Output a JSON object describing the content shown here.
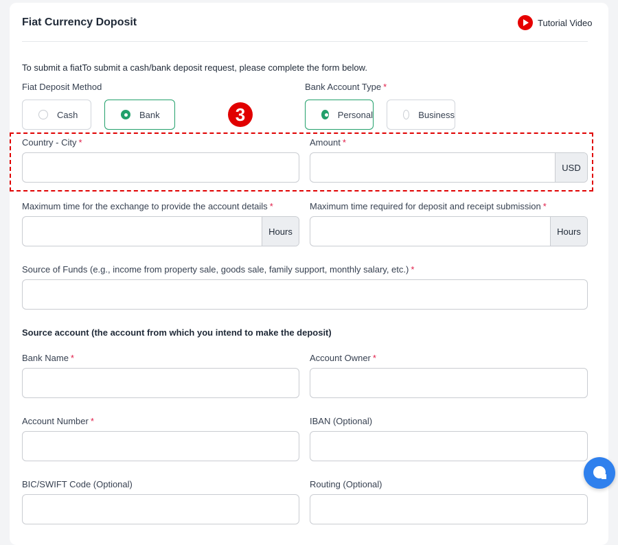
{
  "header": {
    "title": "Fiat Currency Doposit",
    "tutorial_label": "Tutorial Video"
  },
  "intro": "To submit a fiatTo submit a cash/bank deposit request, please complete the form below.",
  "deposit_method": {
    "label": "Fiat Deposit Method",
    "options": [
      {
        "label": "Cash",
        "selected": false
      },
      {
        "label": "Bank",
        "selected": true
      }
    ]
  },
  "account_type": {
    "label": "Bank Account Type",
    "required_mark": "*",
    "options": [
      {
        "label": "Personal",
        "selected": true
      },
      {
        "label": "Business",
        "selected": false
      }
    ]
  },
  "step_marker": "3",
  "fields": {
    "country_city": {
      "label": "Country - City",
      "required_mark": "*",
      "value": ""
    },
    "amount": {
      "label": "Amount",
      "required_mark": "*",
      "value": "",
      "suffix": "USD"
    },
    "max_time_exchange": {
      "label": "Maximum time for the exchange to provide the account details",
      "required_mark": "*",
      "value": "",
      "suffix": "Hours"
    },
    "max_time_deposit": {
      "label": "Maximum time required for deposit and receipt submission",
      "required_mark": "*",
      "value": "",
      "suffix": "Hours"
    },
    "source_of_funds": {
      "label": "Source of Funds (e.g., income from property sale, goods sale, family support, monthly salary, etc.)",
      "required_mark": "*",
      "value": ""
    },
    "bank_name": {
      "label": "Bank Name",
      "required_mark": "*",
      "value": ""
    },
    "account_owner": {
      "label": "Account Owner",
      "required_mark": "*",
      "value": ""
    },
    "account_number": {
      "label": "Account Number",
      "required_mark": "*",
      "value": ""
    },
    "iban": {
      "label": "IBAN (Optional)",
      "value": ""
    },
    "bic_swift": {
      "label": "BIC/SWIFT Code (Optional)",
      "value": ""
    },
    "routing": {
      "label": "Routing (Optional)",
      "value": ""
    }
  },
  "source_account_title": "Source account (the account from which you intend to make the deposit)",
  "colors": {
    "accent_green": "#22a06b",
    "required_red": "#e11d48",
    "annotation_red": "#e00000",
    "chat_blue": "#2f80ed"
  }
}
